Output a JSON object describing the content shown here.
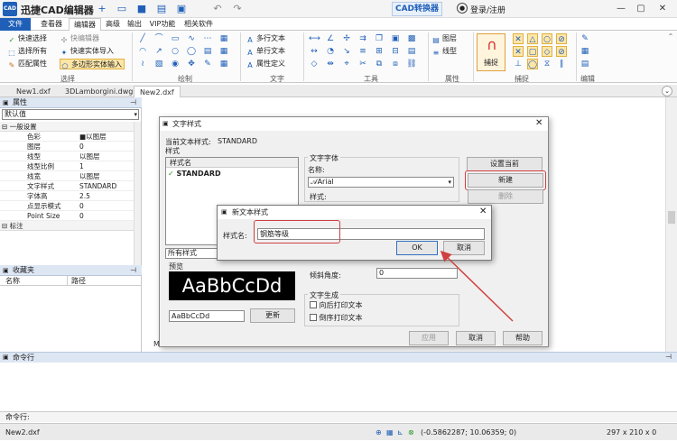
{
  "app": {
    "title": "迅捷CAD编辑器",
    "logo": "CAD",
    "convert_btn": "CAD转换器",
    "login": "登录/注册"
  },
  "menu": {
    "tabs": [
      "文件",
      "查看器",
      "编辑器",
      "高级",
      "输出",
      "VIP功能",
      "相关软件"
    ],
    "active": "编辑器"
  },
  "ribbon": {
    "select": {
      "quick_select": "快速选择",
      "select_all": "选择所有",
      "match_props": "匹配属性",
      "quick_editor": "快编辑器",
      "quick_import": "快速实体导入",
      "poly_import": "多边形实体输入",
      "label": "选择"
    },
    "draw": {
      "label": "绘制"
    },
    "text": {
      "multiline": "多行文本",
      "singleline": "单行文本",
      "attr_def": "属性定义",
      "label": "文字"
    },
    "tools": {
      "label": "工具"
    },
    "props": {
      "layer": "图层",
      "linetype": "线型",
      "label": "属性"
    },
    "snap": {
      "btn": "捕捉",
      "label": "捕捉"
    },
    "edit": {
      "label": "编辑"
    }
  },
  "doc_tabs": [
    "New1.dxf",
    "3DLamborgini.dwg",
    "New2.dxf"
  ],
  "props_panel": {
    "title": "属性",
    "dropdown": "默认值",
    "group_general": "一般设置",
    "rows": [
      {
        "k": "色彩",
        "v": "■以图层"
      },
      {
        "k": "图层",
        "v": "0"
      },
      {
        "k": "线型",
        "v": "以图层"
      },
      {
        "k": "线型比例",
        "v": "1"
      },
      {
        "k": "线宽",
        "v": "以图层"
      },
      {
        "k": "文字样式",
        "v": "STANDARD"
      },
      {
        "k": "字体高",
        "v": "2.5"
      },
      {
        "k": "点显示模式",
        "v": "0"
      },
      {
        "k": "Point Size",
        "v": "0"
      }
    ],
    "group_mark": "标注"
  },
  "favorites": {
    "title": "收藏夹",
    "col_name": "名称",
    "col_path": "路径"
  },
  "text_style_dialog": {
    "title": "文字样式",
    "current_label": "当前文本样式:",
    "current_value": "STANDARD",
    "style_group": "样式",
    "style_list_header": "样式名",
    "style_item": "STANDARD",
    "filter": "所有样式",
    "preview_label": "预览",
    "preview_text": "AaBbCcDd",
    "preview_input": "AaBbCcDd",
    "update_btn": "更新",
    "font_group": "文字字体",
    "font_name_label": "名称:",
    "font_value": "Arial",
    "style_label": "样式:",
    "oblique_label": "倾斜角度:",
    "oblique_value": "0",
    "gen_group": "文字生成",
    "backward": "向后打印文本",
    "upside": "倒序打印文本",
    "set_current": "设置当前",
    "new_btn": "新建",
    "delete_btn": "删除",
    "apply_btn": "应用",
    "cancel_btn": "取消",
    "help_btn": "帮助",
    "stray": "M"
  },
  "new_style_dialog": {
    "title": "新文本样式",
    "name_label": "样式名:",
    "name_value": "钢筋等级",
    "ok": "OK",
    "cancel": "取消"
  },
  "command": {
    "title": "命令行",
    "prompt": "命令行:"
  },
  "status": {
    "file": "New2.dxf",
    "coords": "(-0.5862287; 10.06359; 0)",
    "size": "297 x 210 x 0"
  },
  "colors": {
    "accent": "#1f5fb8",
    "highlight": "#d04040"
  }
}
